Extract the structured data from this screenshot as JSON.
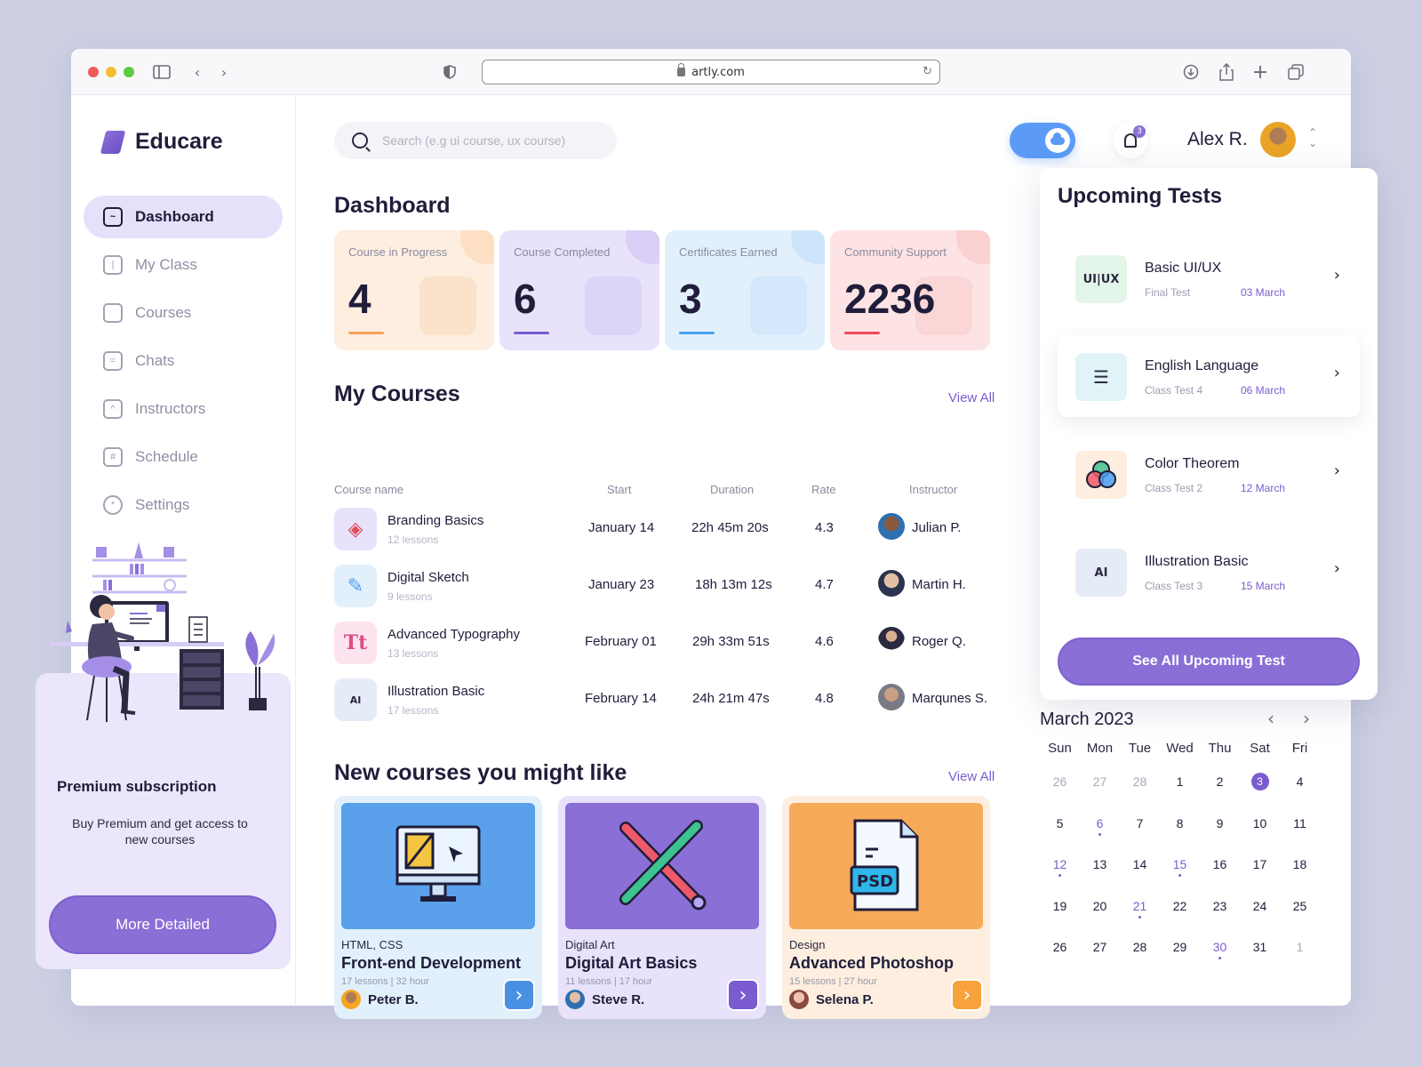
{
  "browser": {
    "url": "artly.com"
  },
  "sidebar": {
    "logo": "Educare",
    "items": [
      {
        "label": "Dashboard",
        "icon": "dashboard-icon",
        "active": true
      },
      {
        "label": "My Class",
        "icon": "book-icon",
        "active": false
      },
      {
        "label": "Courses",
        "icon": "folder-icon",
        "active": false
      },
      {
        "label": "Chats",
        "icon": "chat-icon",
        "active": false
      },
      {
        "label": "Instructors",
        "icon": "graduation-cap-icon",
        "active": false
      },
      {
        "label": "Schedule",
        "icon": "calendar-icon",
        "active": false
      },
      {
        "label": "Settings",
        "icon": "gear-icon",
        "active": false
      }
    ],
    "premium": {
      "title": "Premium subscription",
      "description": "Buy Premium and get access to new courses",
      "button": "More Detailed"
    }
  },
  "header": {
    "search_placeholder": "Search (e.g ui course, ux course)",
    "notifications_count": "3",
    "user_name": "Alex R."
  },
  "dashboard": {
    "title": "Dashboard",
    "stats": [
      {
        "label": "Course in Progress",
        "value": "4",
        "color": "#f5a35a",
        "bg": "#fdeee0"
      },
      {
        "label": "Course Completed",
        "value": "6",
        "color": "#7a5cd0",
        "bg": "#e8e2fa"
      },
      {
        "label": "Certificates Earned",
        "value": "3",
        "color": "#4a9ff0",
        "bg": "#e2f0fc"
      },
      {
        "label": "Community Support",
        "value": "2236",
        "color": "#ef4b5a",
        "bg": "#fde3e3"
      }
    ]
  },
  "my_courses": {
    "title": "My Courses",
    "view_all": "View All",
    "columns": [
      "Course name",
      "Start",
      "Duration",
      "Rate",
      "Instructor"
    ],
    "rows": [
      {
        "name": "Branding Basics",
        "lessons": "12 lessons",
        "start": "January 14",
        "duration": "22h 45m 20s",
        "rate": "4.3",
        "instructor": "Julian P."
      },
      {
        "name": "Digital Sketch",
        "lessons": "9 lessons",
        "start": "January 23",
        "duration": "18h 13m 12s",
        "rate": "4.7",
        "instructor": "Martin H."
      },
      {
        "name": "Advanced Typography",
        "lessons": "13 lessons",
        "start": "February 01",
        "duration": "29h 33m 51s",
        "rate": "4.6",
        "instructor": "Roger Q."
      },
      {
        "name": "Illustration Basic",
        "lessons": "17 lessons",
        "start": "February 14",
        "duration": "24h 21m 47s",
        "rate": "4.8",
        "instructor": "Marqunes S."
      }
    ]
  },
  "new_courses": {
    "title": "New courses you might like",
    "view_all": "View All",
    "cards": [
      {
        "category": "HTML, CSS",
        "title": "Front-end Development",
        "meta": "17 lessons | 32 hour",
        "author": "Peter B."
      },
      {
        "category": "Digital Art",
        "title": "Digital Art Basics",
        "meta": "11 lessons | 17 hour",
        "author": "Steve R."
      },
      {
        "category": "Design",
        "title": "Advanced Photoshop",
        "meta": "15 lessons | 27 hour",
        "author": "Selena P."
      }
    ]
  },
  "upcoming_tests": {
    "title": "Upcoming Tests",
    "items": [
      {
        "name": "Basic UI/UX",
        "type": "Final Test",
        "date": "03 March"
      },
      {
        "name": "English Language",
        "type": "Class Test 4",
        "date": "06 March"
      },
      {
        "name": "Color Theorem",
        "type": "Class Test 2",
        "date": "12 March"
      },
      {
        "name": "Illustration Basic",
        "type": "Class Test 3",
        "date": "15 March"
      }
    ],
    "button": "See All Upcoming Test"
  },
  "calendar": {
    "title": "March 2023",
    "weekdays": [
      "Sun",
      "Mon",
      "Tue",
      "Wed",
      "Thu",
      "Sat",
      "Fri"
    ],
    "weeks": [
      [
        "26",
        "27",
        "28",
        "1",
        "2",
        "3",
        "4"
      ],
      [
        "5",
        "6",
        "7",
        "8",
        "9",
        "10",
        "11"
      ],
      [
        "12",
        "13",
        "14",
        "15",
        "16",
        "17",
        "18"
      ],
      [
        "19",
        "20",
        "21",
        "22",
        "23",
        "24",
        "25"
      ],
      [
        "26",
        "27",
        "28",
        "29",
        "30",
        "31",
        "1"
      ]
    ],
    "selected_day": "3",
    "marked_days": [
      "6",
      "12",
      "15",
      "21",
      "30"
    ]
  }
}
